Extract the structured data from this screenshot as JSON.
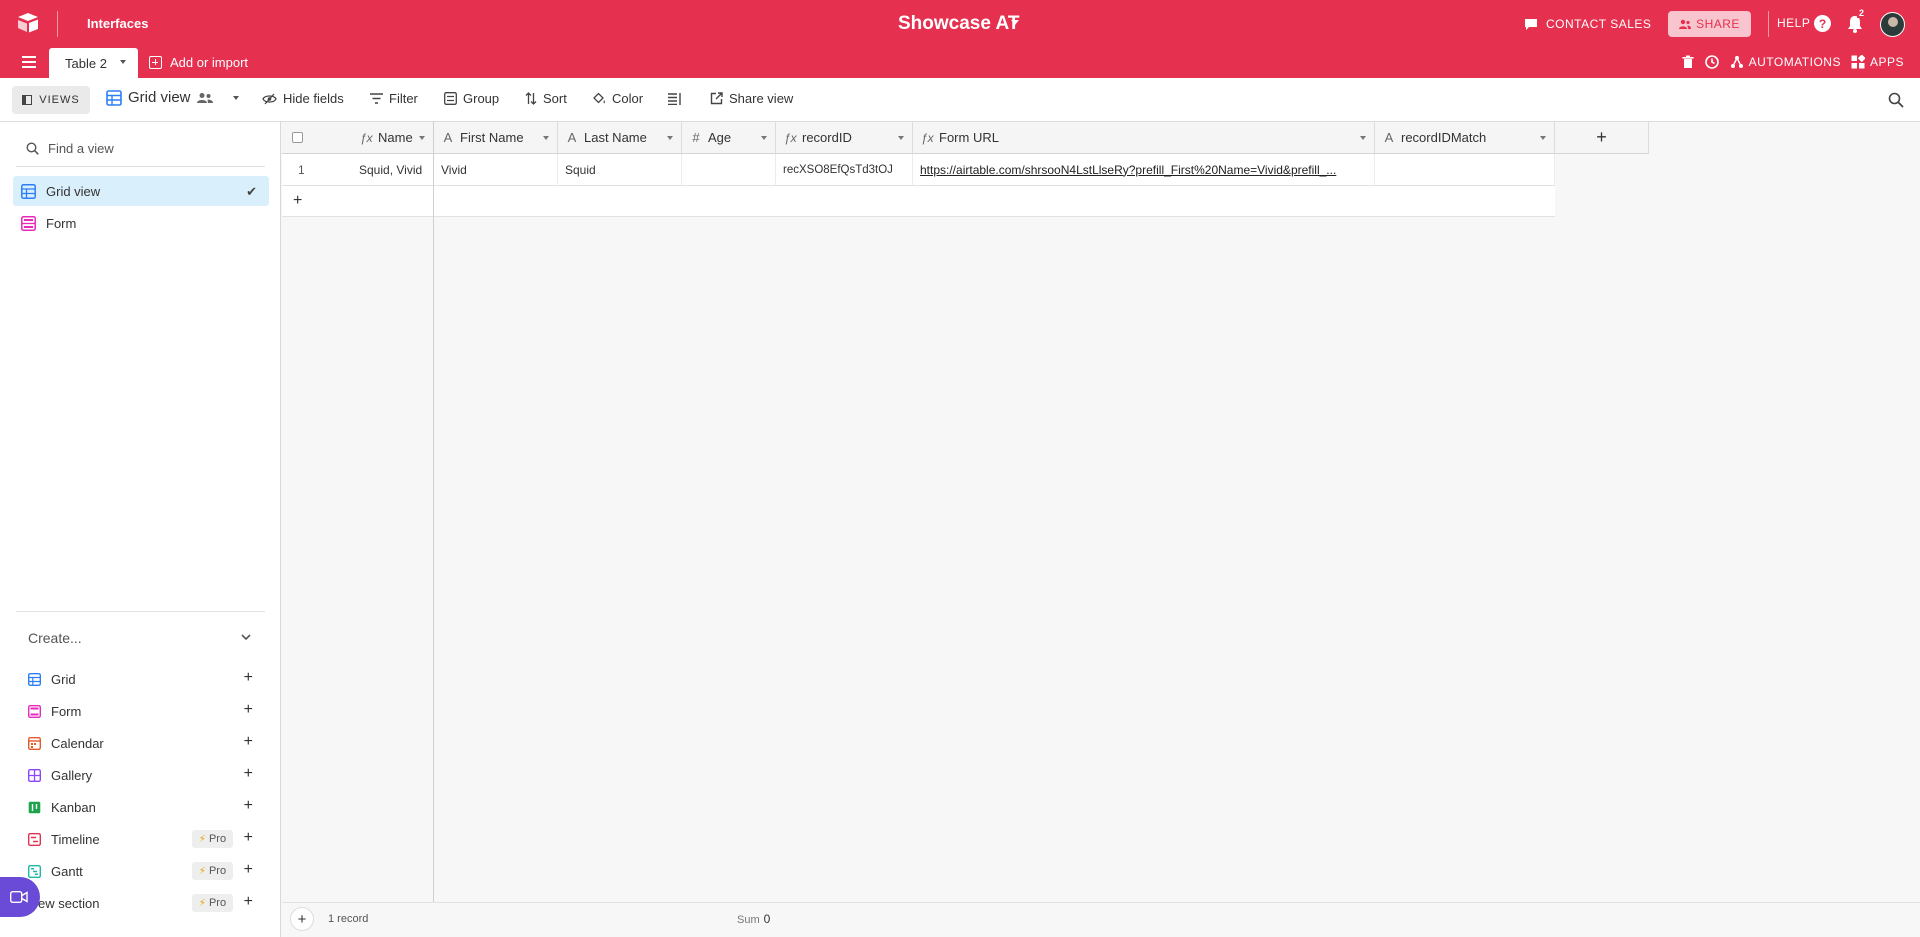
{
  "topbar": {
    "interfaces": "Interfaces",
    "base_title": "Showcase AT",
    "contact_sales": "CONTACT SALES",
    "share": "SHARE",
    "help": "HELP",
    "help_glyph": "?",
    "notification_count": "2",
    "accent": "#e5304f"
  },
  "tabs": {
    "active_table": "Table 2",
    "add_import": "Add or import"
  },
  "toolbar_right": {
    "automations": "AUTOMATIONS",
    "apps": "APPS"
  },
  "viewbar": {
    "views": "VIEWS",
    "grid_view": "Grid view",
    "hide_fields": "Hide fields",
    "filter": "Filter",
    "group": "Group",
    "sort": "Sort",
    "color": "Color",
    "share_view": "Share view"
  },
  "sidebar": {
    "find_placeholder": "Find a view",
    "views": [
      {
        "label": "Grid view",
        "icon": "grid-icon",
        "color": "#2d7ff9",
        "active": true
      },
      {
        "label": "Form",
        "icon": "form-icon",
        "color": "#e929ba",
        "active": false
      }
    ],
    "create_label": "Create...",
    "create_items": [
      {
        "label": "Grid",
        "icon": "grid-icon",
        "color": "#2d7ff9",
        "pro": false
      },
      {
        "label": "Form",
        "icon": "form-icon",
        "color": "#e929ba",
        "pro": false
      },
      {
        "label": "Calendar",
        "icon": "calendar-icon",
        "color": "#e35d2b",
        "pro": false
      },
      {
        "label": "Gallery",
        "icon": "gallery-icon",
        "color": "#8b46ff",
        "pro": false
      },
      {
        "label": "Kanban",
        "icon": "kanban-icon",
        "color": "#20a34d",
        "pro": false
      },
      {
        "label": "Timeline",
        "icon": "timeline-icon",
        "color": "#e5304f",
        "pro": true
      },
      {
        "label": "Gantt",
        "icon": "gantt-icon",
        "color": "#1fb8a6",
        "pro": true
      },
      {
        "label": "ew section",
        "icon": "section-icon",
        "color": "#999999",
        "pro": true
      }
    ],
    "pro_label": "Pro"
  },
  "grid": {
    "columns": [
      {
        "label": "Name",
        "icon": "formula-icon",
        "glyph": "ƒx"
      },
      {
        "label": "First Name",
        "icon": "text-icon",
        "glyph": "A"
      },
      {
        "label": "Last Name",
        "icon": "text-icon",
        "glyph": "A"
      },
      {
        "label": "Age",
        "icon": "number-icon",
        "glyph": "#"
      },
      {
        "label": "recordID",
        "icon": "formula-icon",
        "glyph": "ƒx"
      },
      {
        "label": "Form URL",
        "icon": "formula-icon",
        "glyph": "ƒx"
      },
      {
        "label": "recordIDMatch",
        "icon": "text-icon",
        "glyph": "A"
      }
    ],
    "rows": [
      {
        "row_number": "1",
        "cells": [
          "Squid, Vivid",
          "Vivid",
          "Squid",
          "",
          "recXSO8EfQsTd3tOJ",
          "https://airtable.com/shrsooN4LstLlseRy?prefill_First%20Name=Vivid&prefill_...",
          ""
        ]
      }
    ],
    "add_glyph": "+",
    "add_field_glyph": "+"
  },
  "footer": {
    "record_count": "1 record",
    "sum_label": "Sum",
    "sum_value": "0"
  }
}
